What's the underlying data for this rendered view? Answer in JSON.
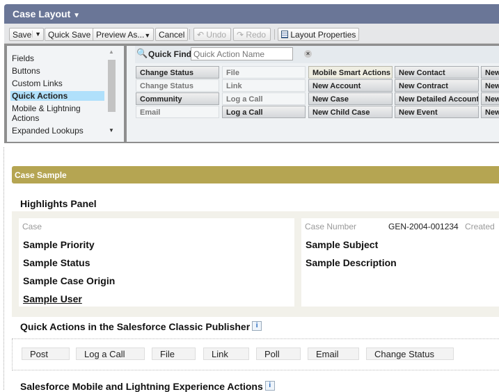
{
  "header": {
    "title": "Case Layout"
  },
  "toolbar": {
    "save": "Save",
    "quick_save": "Quick Save",
    "preview": "Preview As...",
    "cancel": "Cancel",
    "undo": "Undo",
    "redo": "Redo",
    "layout_properties": "Layout Properties"
  },
  "palette": {
    "categories": [
      "Fields",
      "Buttons",
      "Custom Links",
      "Quick Actions",
      "Mobile & Lightning Actions",
      "Expanded Lookups"
    ],
    "selected": "Quick Actions",
    "quick_find_label": "Quick Find",
    "quick_find_placeholder": "Quick Action Name",
    "columns": [
      [
        {
          "t": "Change Status",
          "s": "on"
        },
        {
          "t": "Change Status",
          "s": "off"
        },
        {
          "t": "Community",
          "s": "on"
        },
        {
          "t": "Email",
          "s": "off"
        }
      ],
      [
        {
          "t": "File",
          "s": "off"
        },
        {
          "t": "Link",
          "s": "off"
        },
        {
          "t": "Log a Call",
          "s": "off"
        },
        {
          "t": "Log a Call",
          "s": "on"
        }
      ],
      [
        {
          "t": "Mobile Smart Actions",
          "s": "cream"
        },
        {
          "t": "New Account",
          "s": "on"
        },
        {
          "t": "New Case",
          "s": "on"
        },
        {
          "t": "New Child Case",
          "s": "on"
        }
      ],
      [
        {
          "t": "New Contact",
          "s": "on"
        },
        {
          "t": "New Contract",
          "s": "on"
        },
        {
          "t": "New Detailed Account",
          "s": "on"
        },
        {
          "t": "New Event",
          "s": "on"
        }
      ],
      [
        {
          "t": "New",
          "s": "on"
        },
        {
          "t": "New",
          "s": "on"
        },
        {
          "t": "New",
          "s": "on"
        },
        {
          "t": "New",
          "s": "on"
        }
      ]
    ]
  },
  "layout": {
    "section_title": "Case Sample",
    "highlights_title": "Highlights Panel",
    "left": {
      "label": "Case",
      "values": [
        "Sample Priority",
        "Sample Status",
        "Sample Case Origin",
        "Sample User"
      ]
    },
    "right": {
      "case_number_label": "Case Number",
      "case_number": "GEN-2004-001234",
      "created_label": "Created",
      "values": [
        "Sample Subject",
        "Sample Description"
      ]
    },
    "classic_title": "Quick Actions in the Salesforce Classic Publisher",
    "classic_actions": [
      "Post",
      "Log a Call",
      "File",
      "Link",
      "Poll",
      "Email",
      "Change Status"
    ],
    "mobile_title": "Salesforce Mobile and Lightning Experience Actions",
    "info": "i"
  }
}
